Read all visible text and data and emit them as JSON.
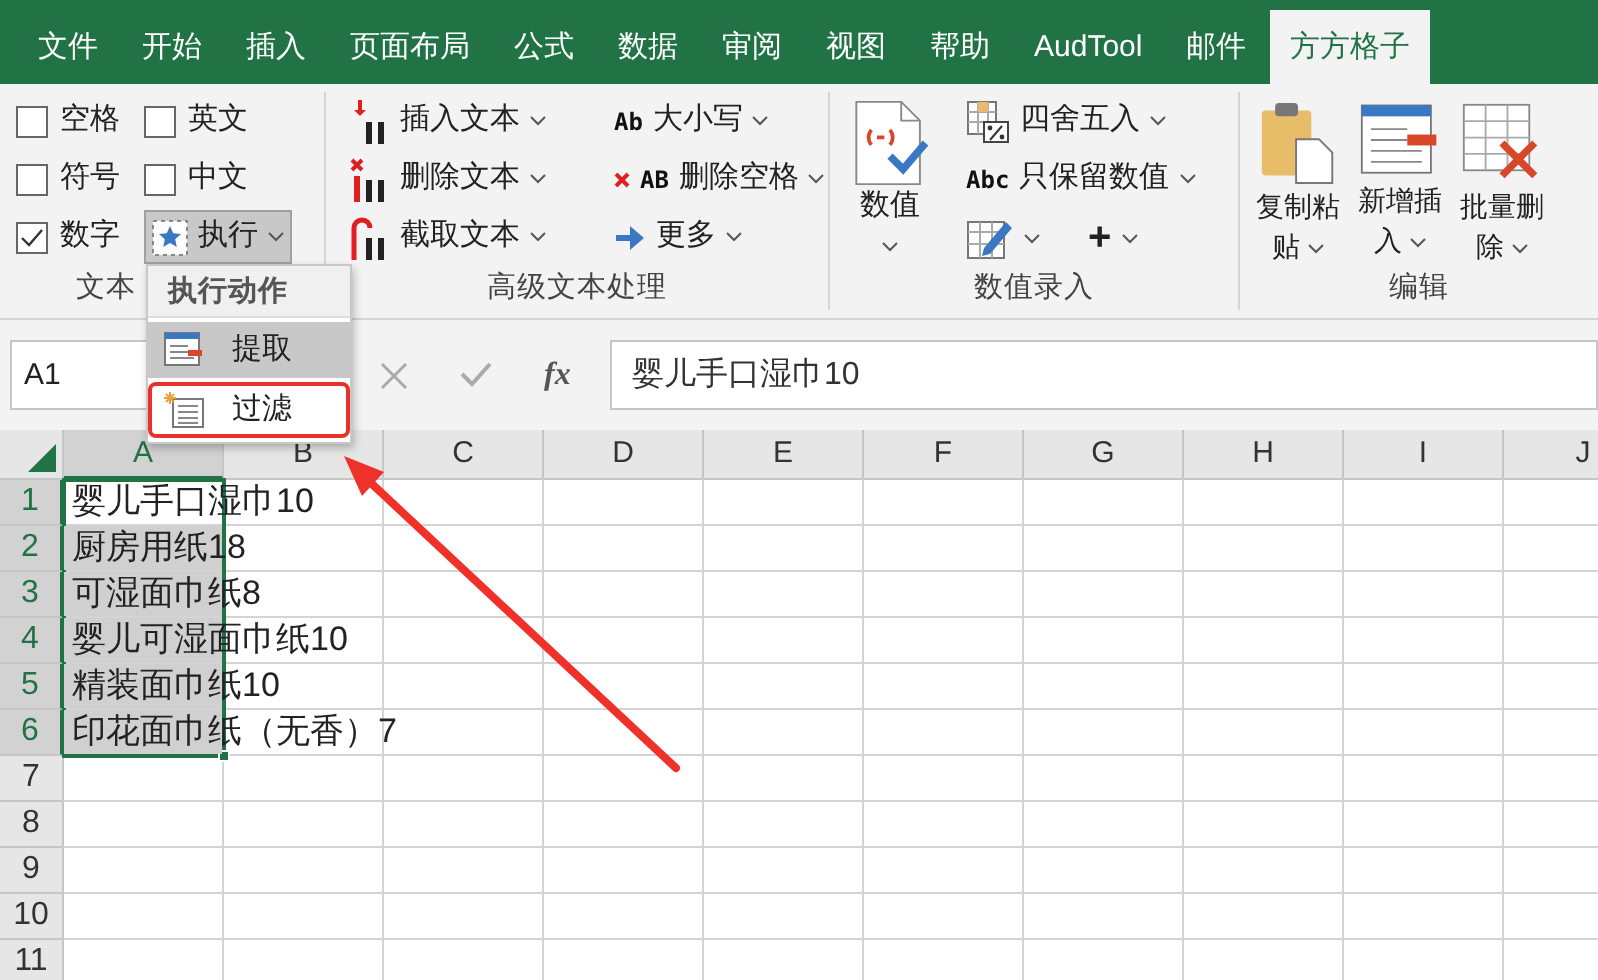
{
  "tabs": [
    {
      "label": "文件",
      "selected": false
    },
    {
      "label": "开始",
      "selected": false
    },
    {
      "label": "插入",
      "selected": false
    },
    {
      "label": "页面布局",
      "selected": false
    },
    {
      "label": "公式",
      "selected": false
    },
    {
      "label": "数据",
      "selected": false
    },
    {
      "label": "审阅",
      "selected": false
    },
    {
      "label": "视图",
      "selected": false
    },
    {
      "label": "帮助",
      "selected": false
    },
    {
      "label": "AudTool",
      "selected": false
    },
    {
      "label": "邮件",
      "selected": false
    },
    {
      "label": "方方格子",
      "selected": true
    }
  ],
  "ribbon_groups": [
    {
      "label": "文本",
      "items": [
        {
          "kind": "checkbox",
          "label": "空格",
          "checked": false
        },
        {
          "kind": "checkbox",
          "label": "符号",
          "checked": false
        },
        {
          "kind": "checkbox",
          "label": "数字",
          "checked": true
        },
        {
          "kind": "checkbox",
          "label": "英文",
          "checked": false
        },
        {
          "kind": "checkbox",
          "label": "中文",
          "checked": false
        },
        {
          "kind": "dropdown",
          "label": "执行",
          "expanded": true
        }
      ]
    },
    {
      "label": "高级文本处理",
      "items": [
        {
          "kind": "small",
          "label": "插入文本"
        },
        {
          "kind": "small",
          "label": "删除文本"
        },
        {
          "kind": "small",
          "label": "截取文本"
        },
        {
          "kind": "small",
          "label": "大小写",
          "icon_text": "Ab"
        },
        {
          "kind": "small",
          "label": "删除空格",
          "icon_text": "AB"
        },
        {
          "kind": "small",
          "label": "更多"
        }
      ]
    },
    {
      "label": "数值录入",
      "items": [
        {
          "kind": "large",
          "label": "数值"
        },
        {
          "kind": "small",
          "label": "四舍五入"
        },
        {
          "kind": "small",
          "label": "只保留数值",
          "icon_text": "Abc"
        },
        {
          "kind": "tools",
          "glyph": "+"
        }
      ]
    },
    {
      "label": "编辑",
      "items": [
        {
          "kind": "large",
          "label": "复制粘贴"
        },
        {
          "kind": "large",
          "label": "新增插入"
        },
        {
          "kind": "large",
          "label": "批量删除"
        }
      ]
    }
  ],
  "menu": {
    "title": "执行动作",
    "items": [
      {
        "label": "提取",
        "selected": true,
        "outlined": false
      },
      {
        "label": "过滤",
        "selected": false,
        "outlined": true
      }
    ]
  },
  "formula_bar": {
    "name_box": "A1",
    "function_label": "fx",
    "formula": "婴儿手口湿巾10"
  },
  "sheet": {
    "columns": [
      {
        "label": "A",
        "selected": true
      },
      {
        "label": "B",
        "selected": false
      },
      {
        "label": "C",
        "selected": false
      },
      {
        "label": "D",
        "selected": false
      },
      {
        "label": "E",
        "selected": false
      },
      {
        "label": "F",
        "selected": false
      },
      {
        "label": "G",
        "selected": false
      },
      {
        "label": "H",
        "selected": false
      },
      {
        "label": "I",
        "selected": false
      },
      {
        "label": "J",
        "selected": false
      }
    ],
    "rows": [
      {
        "label": "1",
        "selected": true,
        "cells": [
          {
            "text": "婴儿手口湿巾10",
            "selected": true,
            "active": true
          }
        ]
      },
      {
        "label": "2",
        "selected": true,
        "cells": [
          {
            "text": "厨房用纸18",
            "selected": true,
            "active": false
          }
        ]
      },
      {
        "label": "3",
        "selected": true,
        "cells": [
          {
            "text": "可湿面巾纸8",
            "selected": true,
            "active": false
          }
        ]
      },
      {
        "label": "4",
        "selected": true,
        "cells": [
          {
            "text": "婴儿可湿面巾纸10",
            "selected": true,
            "active": false
          }
        ]
      },
      {
        "label": "5",
        "selected": true,
        "cells": [
          {
            "text": "精装面巾纸10",
            "selected": true,
            "active": false
          }
        ]
      },
      {
        "label": "6",
        "selected": true,
        "cells": [
          {
            "text": "印花面巾纸（无香）7",
            "selected": true,
            "active": false
          }
        ]
      },
      {
        "label": "7",
        "selected": false
      },
      {
        "label": "8",
        "selected": false
      },
      {
        "label": "9",
        "selected": false
      },
      {
        "label": "10",
        "selected": false
      },
      {
        "label": "11",
        "selected": false
      }
    ]
  },
  "callout_arrow": true
}
